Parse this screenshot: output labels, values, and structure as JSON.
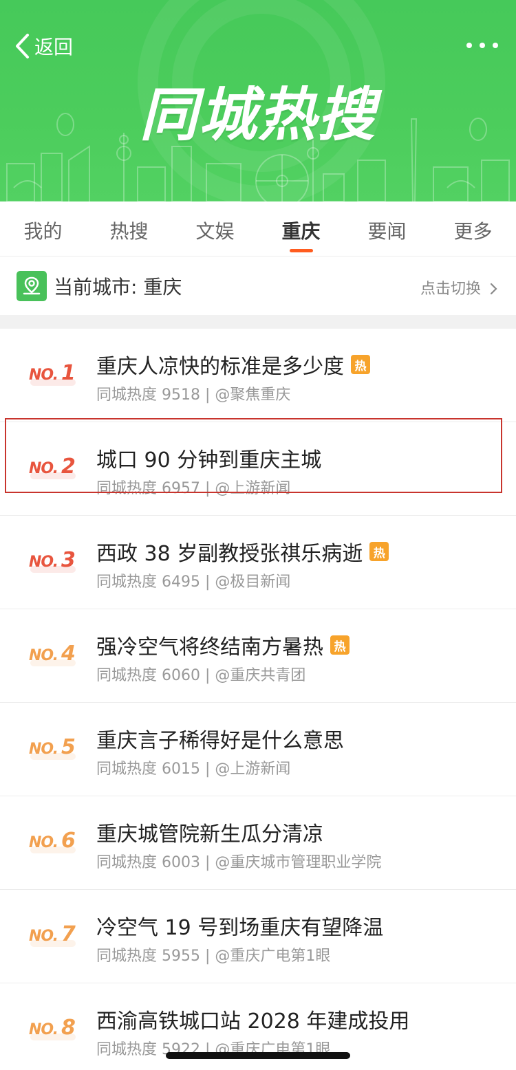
{
  "header": {
    "back_label": "返回",
    "title": "同城热搜",
    "background_color": "#4ccd5c"
  },
  "tabs": [
    {
      "label": "我的",
      "active": false
    },
    {
      "label": "热搜",
      "active": false
    },
    {
      "label": "文娱",
      "active": false
    },
    {
      "label": "重庆",
      "active": true
    },
    {
      "label": "要闻",
      "active": false
    },
    {
      "label": "更多",
      "active": false
    }
  ],
  "city": {
    "label": "当前城市: 重庆",
    "switch_label": "点击切换"
  },
  "hot_badge": "热",
  "rank_prefix": "NO.",
  "items": [
    {
      "rank": "1",
      "title": "重庆人凉快的标准是多少度",
      "hot": true,
      "meta": "同城热度 9518 | @聚焦重庆",
      "rank_color": "#e8553e"
    },
    {
      "rank": "2",
      "title": "城口 90 分钟到重庆主城",
      "hot": false,
      "meta": "同城热度 6957 | @上游新闻",
      "rank_color": "#e8553e"
    },
    {
      "rank": "3",
      "title": "西政 38 岁副教授张祺乐病逝",
      "hot": true,
      "meta": "同城热度 6495 | @极目新闻",
      "rank_color": "#e8553e"
    },
    {
      "rank": "4",
      "title": "强冷空气将终结南方暑热",
      "hot": true,
      "meta": "同城热度 6060 | @重庆共青团",
      "rank_color": "#f2a04f"
    },
    {
      "rank": "5",
      "title": "重庆言子稀得好是什么意思",
      "hot": false,
      "meta": "同城热度 6015 | @上游新闻",
      "rank_color": "#f2a04f"
    },
    {
      "rank": "6",
      "title": "重庆城管院新生瓜分清凉",
      "hot": false,
      "meta": "同城热度 6003 | @重庆城市管理职业学院",
      "rank_color": "#f2a04f"
    },
    {
      "rank": "7",
      "title": "冷空气 19 号到场重庆有望降温",
      "hot": false,
      "meta": "同城热度 5955 | @重庆广电第1眼",
      "rank_color": "#f2a04f"
    },
    {
      "rank": "8",
      "title": "西渝高铁城口站 2028 年建成投用",
      "hot": false,
      "meta": "同城热度 5922 | @重庆广电第1眼",
      "rank_color": "#f2a04f"
    }
  ]
}
